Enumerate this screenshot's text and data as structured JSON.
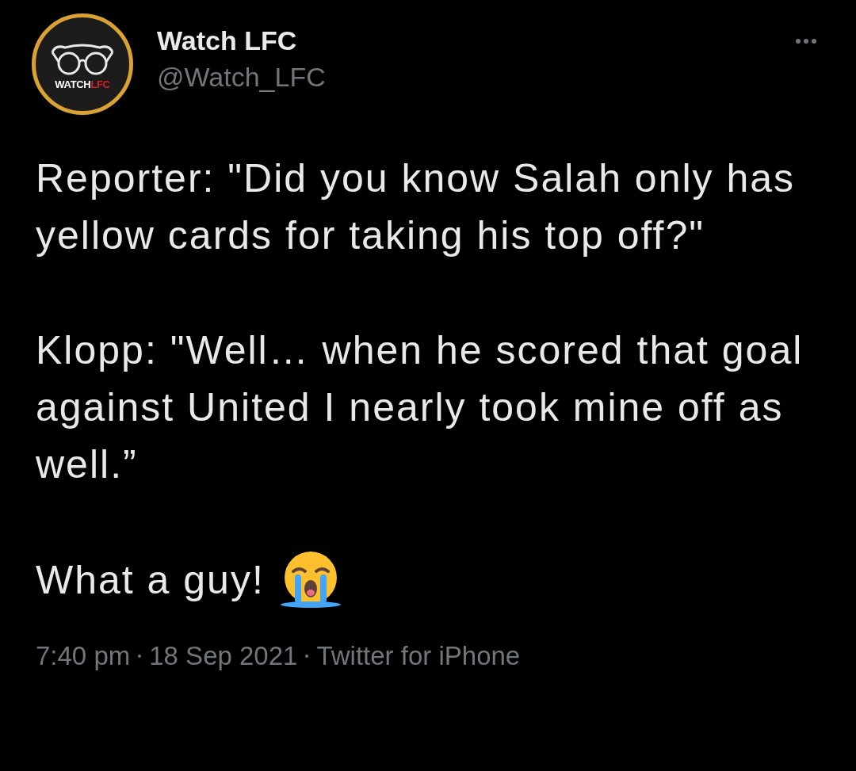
{
  "author": {
    "name": "Watch LFC",
    "handle": "@Watch_LFC",
    "logo_text": [
      {
        "text": "WATCH",
        "color": "#ffffff"
      },
      {
        "text": "LFC",
        "color": "#d81f26"
      }
    ]
  },
  "paragraphs": [
    {
      "text": "Reporter: \"Did you know Salah only has yellow cards for taking his top off?\"",
      "emoji": false
    },
    {
      "text": "Klopp: \"Well… when he scored that goal against United I nearly took mine off as well.”",
      "emoji": false
    },
    {
      "text": "What a guy!",
      "emoji": true
    }
  ],
  "footer": {
    "time": "7:40 pm",
    "date": "18 Sep 2021",
    "source": "Twitter for iPhone"
  }
}
